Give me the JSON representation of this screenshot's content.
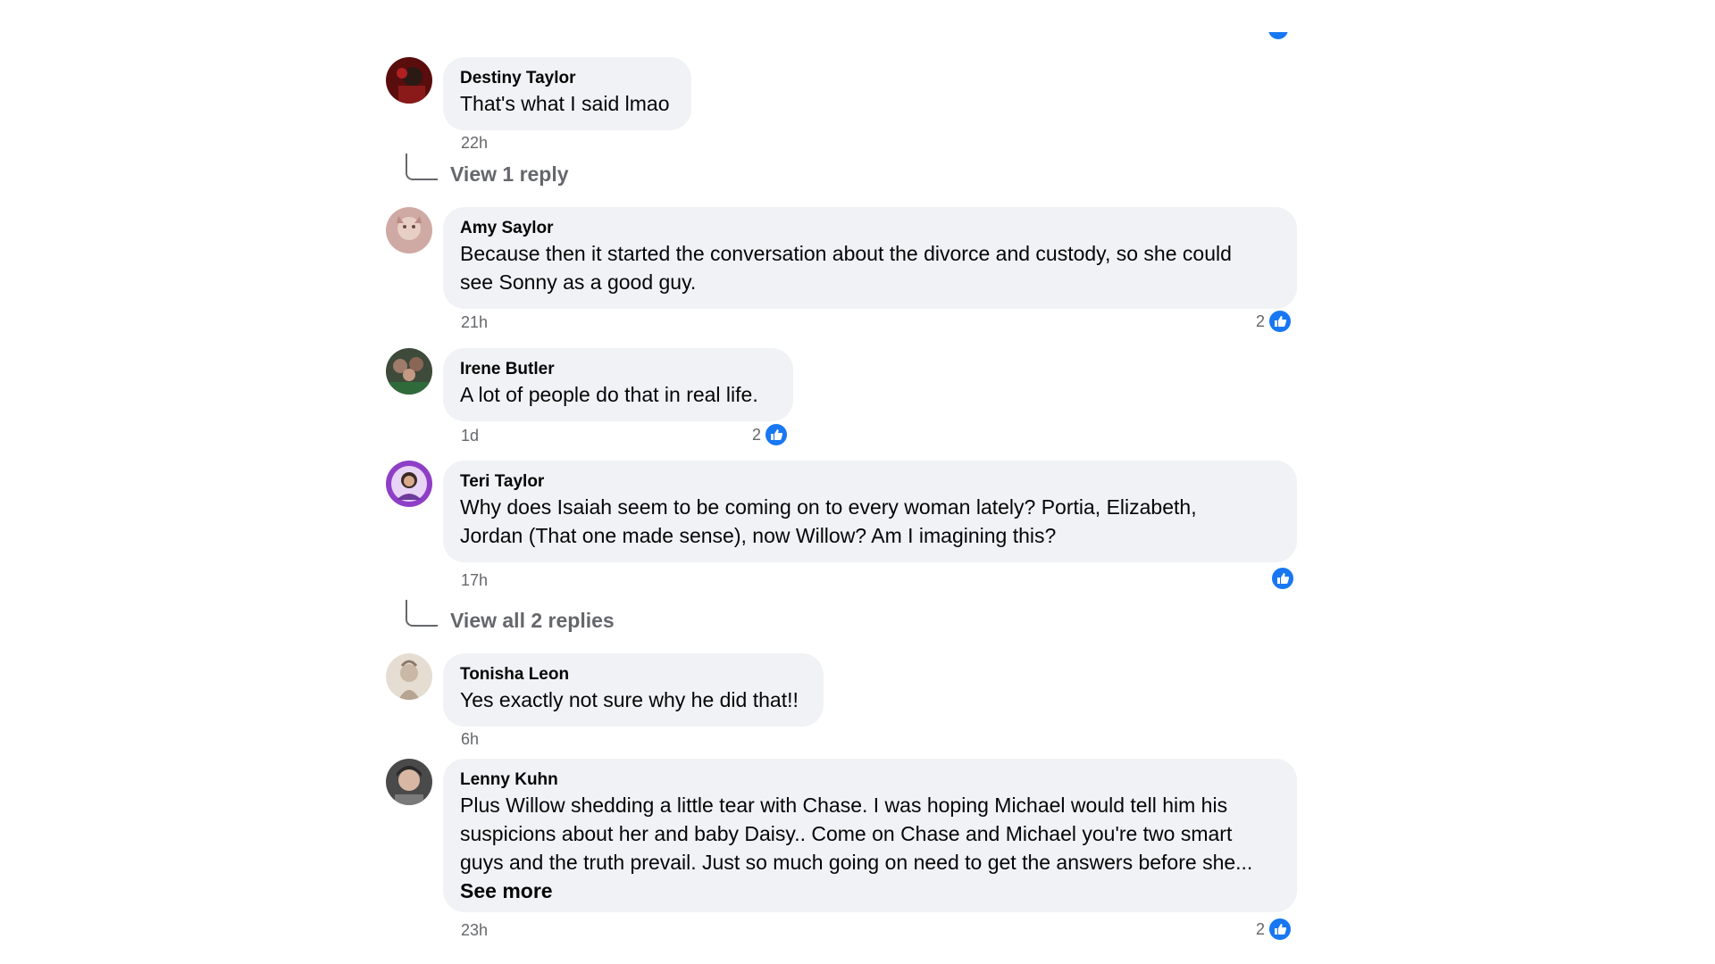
{
  "comments": [
    {
      "author": "Destiny Taylor",
      "text": "That's what I said lmao",
      "time": "22h",
      "view_replies": "View 1 reply"
    },
    {
      "author": "Amy Saylor",
      "text_line1": "Because then it started the conversation about the divorce and custody, so she could",
      "text_line2": "see Sonny as a good guy.",
      "time": "21h",
      "reaction_count": "2"
    },
    {
      "author": "Irene Butler",
      "text": "A lot of people do that in real life.",
      "time": "1d",
      "reaction_count": "2"
    },
    {
      "author": "Teri Taylor",
      "text_line1": "Why does Isaiah seem to be coming on to every woman lately? Portia, Elizabeth,",
      "text_line2": "Jordan (That one made sense), now Willow? Am I imagining this?",
      "time": "17h",
      "view_replies": "View all 2 replies"
    },
    {
      "author": "Tonisha Leon",
      "text": "Yes exactly not sure why he did that!!",
      "time": "6h"
    },
    {
      "author": "Lenny Kuhn",
      "text_line1": "Plus Willow shedding a little tear with Chase. I was hoping Michael would tell him his",
      "text_line2": "suspicions about her and baby Daisy.. Come on Chase and Michael you're two smart",
      "text_line3": "guys and the truth prevail. Just so much going on need to get the answers before she...",
      "see_more": "See more",
      "time": "23h",
      "reaction_count": "2"
    }
  ],
  "colors": {
    "bubble": "#f0f2f5",
    "meta_text": "#65676b",
    "like_blue": "#1877f2"
  },
  "icons": {
    "like": "thumbs-up-icon",
    "connector": "reply-connector-line"
  }
}
